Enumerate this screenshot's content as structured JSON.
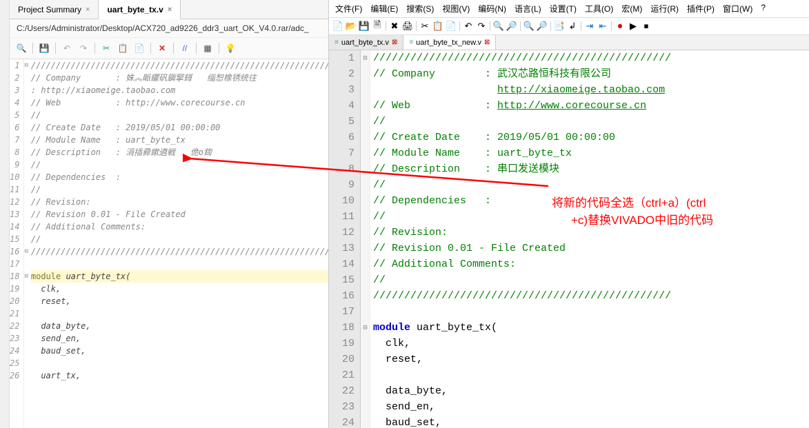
{
  "left": {
    "tabs": [
      {
        "label": "Project Summary"
      },
      {
        "label": "uart_byte_tx.v"
      }
    ],
    "active_tab": 1,
    "path": "C:/Users/Administrator/Desktop/ACX720_ad9226_ddr3_uart_OK_V4.0.rar/adc_",
    "lines": [
      "//////////////////////////////////////////////////////////////",
      "// Company       : 姝︽眽鑺矾鎭掔鎶   缁惒橡锈统往",
      ": http://xiaomeige.taobao.com",
      "// Web           : http://www.corecourse.cn",
      "//",
      "// Create Date   : 2019/05/01 00:00:00",
      "// Module Name   : uart_byte_tx",
      "// Description   : 涓插彛鏉遴戦   佹o鍧",
      "//",
      "// Dependencies  :",
      "//",
      "// Revision:",
      "// Revision 0.01 - File Created",
      "// Additional Comments:",
      "//",
      "//////////////////////////////////////////////////////////////",
      "",
      "module uart_byte_tx(",
      "  clk,",
      "  reset,",
      "",
      "  data_byte,",
      "  send_en,",
      "  baud_set,",
      "",
      "  uart_tx,"
    ]
  },
  "right": {
    "menu": [
      "文件(F)",
      "编辑(E)",
      "搜索(S)",
      "视图(V)",
      "编码(N)",
      "语言(L)",
      "设置(T)",
      "工具(O)",
      "宏(M)",
      "运行(R)",
      "插件(P)",
      "窗口(W)",
      "?"
    ],
    "tabs": [
      {
        "label": "uart_byte_tx.v"
      },
      {
        "label": "uart_byte_tx_new.v"
      }
    ],
    "active_tab": 1,
    "code_lines": [
      {
        "t": "cmt",
        "text": "////////////////////////////////////////////////"
      },
      {
        "t": "cmt",
        "text": "// Company        : 武汉芯路恒科技有限公司"
      },
      {
        "t": "lnk",
        "text": "                    http://xiaomeige.taobao.com"
      },
      {
        "t": "mix",
        "pre": "// Web            : ",
        "link": "http://www.corecourse.cn"
      },
      {
        "t": "cmt",
        "text": "//"
      },
      {
        "t": "cmt",
        "text": "// Create Date    : 2019/05/01 00:00:00"
      },
      {
        "t": "cmt",
        "text": "// Module Name    : uart_byte_tx"
      },
      {
        "t": "cmt",
        "text": "// Description    : 串口发送模块"
      },
      {
        "t": "cmt",
        "text": "//"
      },
      {
        "t": "cmt",
        "text": "// Dependencies   :"
      },
      {
        "t": "cmt",
        "text": "//"
      },
      {
        "t": "cmt",
        "text": "// Revision:"
      },
      {
        "t": "cmt",
        "text": "// Revision 0.01 - File Created"
      },
      {
        "t": "cmt",
        "text": "// Additional Comments:"
      },
      {
        "t": "cmt",
        "text": "//"
      },
      {
        "t": "cmt",
        "text": "////////////////////////////////////////////////"
      },
      {
        "t": "",
        "text": ""
      },
      {
        "t": "mod",
        "kw": "module",
        "rest": " uart_byte_tx("
      },
      {
        "t": "",
        "text": "  clk,"
      },
      {
        "t": "",
        "text": "  reset,"
      },
      {
        "t": "",
        "text": ""
      },
      {
        "t": "",
        "text": "  data_byte,"
      },
      {
        "t": "",
        "text": "  send_en,"
      },
      {
        "t": "",
        "text": "  baud_set,"
      }
    ]
  },
  "annotation": {
    "line1": "将新的代码全选（ctrl+a）(ctrl",
    "line2": "+c)替换VIVADO中旧的代码"
  }
}
